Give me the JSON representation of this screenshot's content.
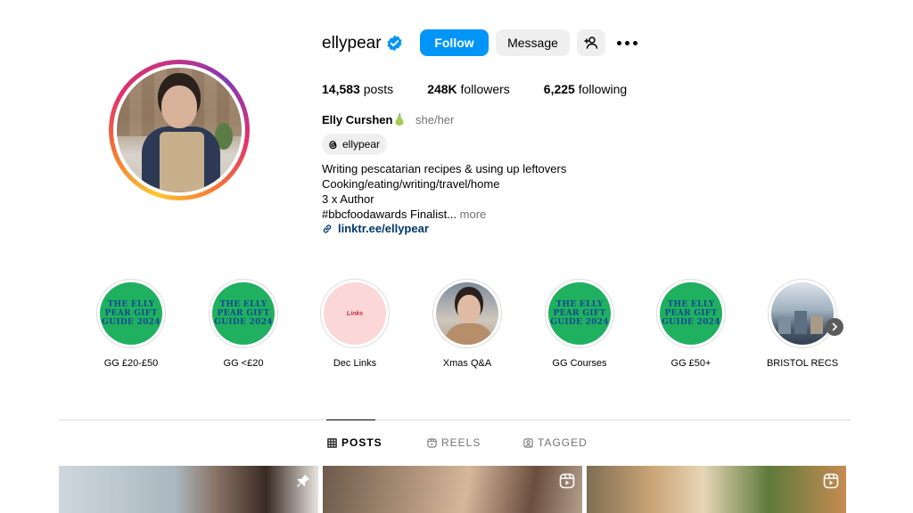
{
  "profile": {
    "username": "ellypear",
    "follow_label": "Follow",
    "message_label": "Message",
    "stats": {
      "posts_value": "14,583",
      "posts_label": "posts",
      "followers_value": "248K",
      "followers_label": "followers",
      "following_value": "6,225",
      "following_label": "following"
    },
    "full_name": "Elly Curshen",
    "pronouns": "she/her",
    "threads_handle": "ellypear",
    "bio": {
      "line1": "Writing pescatarian recipes & using up leftovers",
      "line2": "Cooking/eating/writing/travel/home",
      "line3": "3 x Author",
      "line4": "#bbcfoodawards Finalist...",
      "more": " more",
      "link": "linktr.ee/ellypear"
    }
  },
  "highlights": [
    {
      "label": "GG £20-£50",
      "cover_text": "THE ELLY PEAR GIFT GUIDE 2024"
    },
    {
      "label": "GG <£20",
      "cover_text": "THE ELLY PEAR GIFT GUIDE 2024"
    },
    {
      "label": "Dec Links",
      "cover_text": "Links"
    },
    {
      "label": "Xmas Q&A"
    },
    {
      "label": "GG Courses",
      "cover_text": "THE ELLY PEAR GIFT GUIDE 2024"
    },
    {
      "label": "GG £50+",
      "cover_text": "THE ELLY PEAR GIFT GUIDE 2024"
    },
    {
      "label": "BRISTOL RECS"
    }
  ],
  "tabs": [
    {
      "label": "POSTS",
      "icon": "grid-icon",
      "active": true
    },
    {
      "label": "REELS",
      "icon": "reels-icon",
      "active": false
    },
    {
      "label": "TAGGED",
      "icon": "tagged-icon",
      "active": false
    }
  ],
  "posts": [
    {
      "badge": "pin-icon"
    },
    {
      "badge": "reel-icon"
    },
    {
      "badge": "reel-icon"
    }
  ],
  "colors": {
    "accent": "#0095f6",
    "link": "#00376b",
    "secondary_text": "#737373",
    "highlight_green": "#1fb060",
    "highlight_text_blue": "#134a8f"
  }
}
